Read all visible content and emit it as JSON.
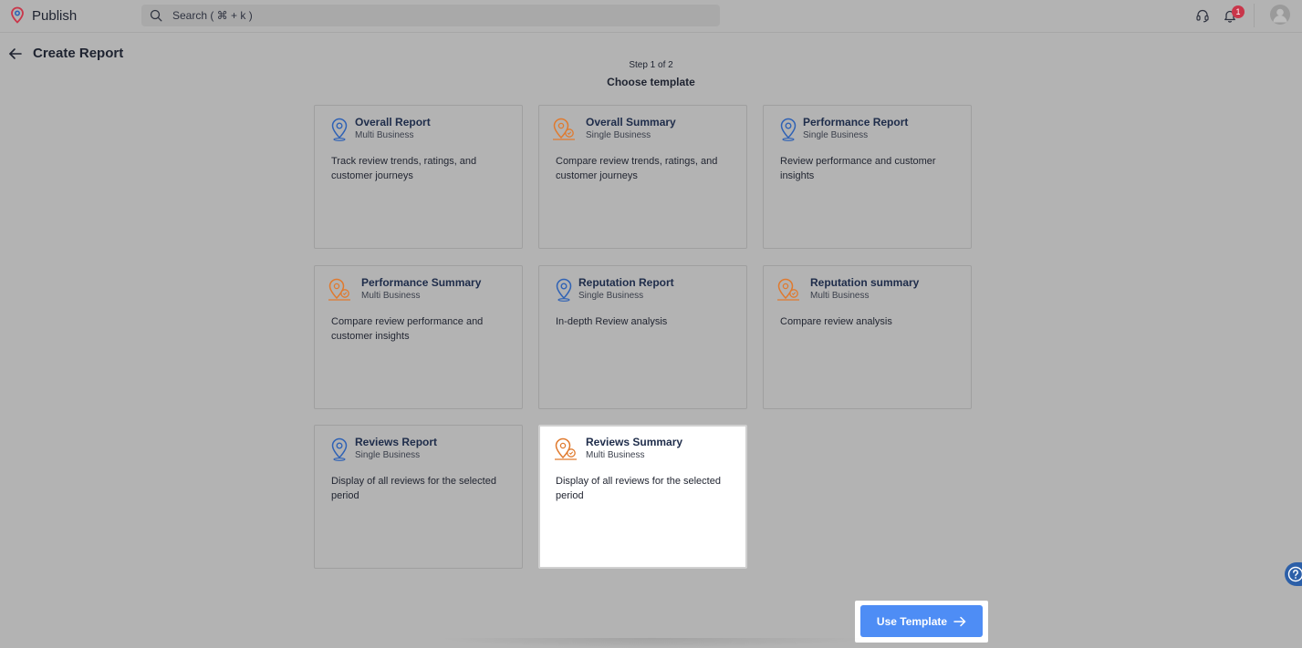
{
  "app": {
    "name": "Publish"
  },
  "search": {
    "placeholder": "Search ( ⌘ + k )"
  },
  "notifications": {
    "count": "1"
  },
  "header": {
    "title": "Create Report"
  },
  "stepper": {
    "step": "Step 1 of 2",
    "title": "Choose template"
  },
  "colors": {
    "accent": "#4e8df5",
    "icon_blue": "#2f62b5",
    "icon_orange": "#e07a2e",
    "badge": "#c9364a"
  },
  "templates": [
    {
      "title": "Overall Report",
      "scope": "Multi Business",
      "description": "Track review trends, ratings, and customer journeys",
      "icon": "location-pin-icon"
    },
    {
      "title": "Overall Summary",
      "scope": "Single Business",
      "description": "Compare review trends, ratings, and customer journeys",
      "icon": "map-pin-summary-icon"
    },
    {
      "title": "Performance Report",
      "scope": "Single Business",
      "description": "Review performance and customer insights",
      "icon": "location-pin-icon"
    },
    {
      "title": "Performance Summary",
      "scope": "Multi Business",
      "description": "Compare review performance and customer insights",
      "icon": "map-pin-summary-icon"
    },
    {
      "title": "Reputation Report",
      "scope": "Single Business",
      "description": "In-depth Review analysis",
      "icon": "location-pin-icon"
    },
    {
      "title": "Reputation summary",
      "scope": "Multi Business",
      "description": "Compare review analysis",
      "icon": "map-pin-summary-icon"
    },
    {
      "title": "Reviews Report",
      "scope": "Single Business",
      "description": "Display of all reviews for the selected period",
      "icon": "location-pin-icon"
    },
    {
      "title": "Reviews Summary",
      "scope": "Multi Business",
      "description": "Display of all reviews for the selected period",
      "icon": "map-pin-summary-icon",
      "selected": true
    }
  ],
  "footer": {
    "use_template_label": "Use Template"
  }
}
